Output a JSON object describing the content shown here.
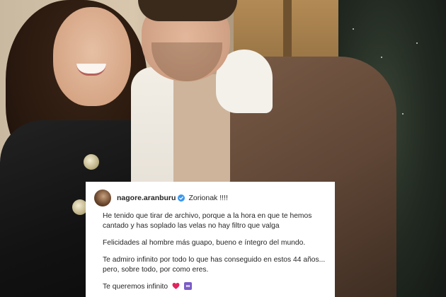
{
  "photo": {
    "colors": {
      "coat": "#121212",
      "jacket": "#5e4535",
      "shearling": "#f2eee6",
      "tree": "#222a22"
    }
  },
  "comment": {
    "username": "nagore.aranburu",
    "verified_icon": "verified-badge-icon",
    "first_line": "Zorionak !!!!",
    "paragraphs": [
      "He tenido que tirar de archivo, porque a la hora en que te hemos cantado y has soplado las velas no hay filtro que valga",
      "Felicidades al hombre más guapo, bueno e íntegro del mundo.",
      "Te admiro infinito por todo lo que has conseguido en estos 44 años... pero, sobre todo, por como eres."
    ],
    "closing_text": "Te queremos infinito",
    "closing_icons": [
      "red-heart-icon",
      "infinity-icon"
    ],
    "colors": {
      "text": "#262626",
      "verified": "#3897f0",
      "heart": "#e0245e",
      "infinity_bg": "#7b5cc7"
    }
  }
}
